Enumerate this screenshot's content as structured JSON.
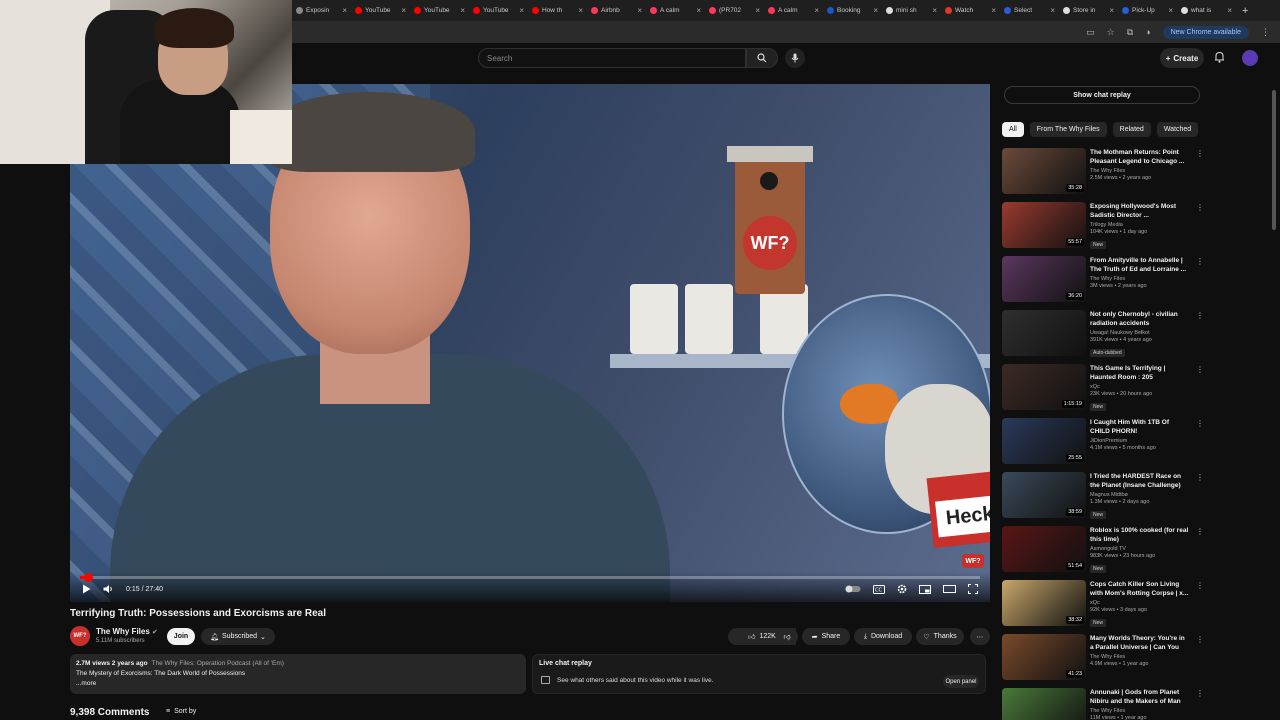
{
  "browser": {
    "tabs": [
      {
        "label": "Exposin",
        "color": "#888888"
      },
      {
        "label": "YouTube",
        "color": "#ff0000"
      },
      {
        "label": "YouTube",
        "color": "#ff0000"
      },
      {
        "label": "YouTube",
        "color": "#ff0000"
      },
      {
        "label": "How th",
        "color": "#ff0000"
      },
      {
        "label": "Airbnb",
        "color": "#ff385c"
      },
      {
        "label": "A calm",
        "color": "#ff385c"
      },
      {
        "label": "(PR702",
        "color": "#ff385c"
      },
      {
        "label": "A calm",
        "color": "#ff385c"
      },
      {
        "label": "Booking",
        "color": "#1a56c4"
      },
      {
        "label": "mini sh",
        "color": "#dddddd"
      },
      {
        "label": "Watch",
        "color": "#e2362b"
      },
      {
        "label": "Select",
        "color": "#2a5cd6"
      },
      {
        "label": "Store in",
        "color": "#dddddd"
      },
      {
        "label": "Pick-Up",
        "color": "#2a5cd6"
      },
      {
        "label": "what is",
        "color": "#dddddd"
      }
    ],
    "update_label": "New Chrome available"
  },
  "header": {
    "search_placeholder": "Search",
    "create_label": "Create"
  },
  "player": {
    "current_time": "0:15",
    "duration": "27:40",
    "time_display": "0:15 / 27:40",
    "progress": 0.009,
    "scene_text": {
      "wf_logo": "WF?",
      "tag": "Heck",
      "corner": "WF?"
    }
  },
  "video": {
    "title": "Terrifying Truth: Possessions and Exorcisms are Real",
    "channel": "The Why Files",
    "subscribers": "5.11M subscribers",
    "join_label": "Join",
    "subscribed_label": "Subscribed",
    "likes": "122K",
    "share_label": "Share",
    "download_label": "Download",
    "thanks_label": "Thanks"
  },
  "description": {
    "meta": "2.7M views  2 years ago",
    "link": "The Why Files: Operation Podcast (All of 'Em)",
    "line": "The Mystery of Exorcisms: The Dark World of Possessions",
    "more": "...more"
  },
  "livechat": {
    "title": "Live chat replay",
    "text": "See what others said about this video while it was live.",
    "open_label": "Open panel"
  },
  "comments": {
    "count_label": "9,398 Comments",
    "sort_label": "Sort by"
  },
  "sidebar": {
    "chat_replay_label": "Show chat replay",
    "chips": [
      "All",
      "From The Why Files",
      "Related",
      "Watched"
    ],
    "items": [
      {
        "title": "The Mothman Returns: Point Pleasant Legend to Chicago ...",
        "channel": "The Why Files",
        "views": "2.5M views • 2 years ago",
        "duration": "35:28",
        "badge": "",
        "color": "#6b4a3a"
      },
      {
        "title": "Exposing Hollywood's Most Sadistic Director ...",
        "channel": "Trilogy Media",
        "views": "104K views • 1 day ago",
        "duration": "55:57",
        "badge": "New",
        "color": "#9a3a2f"
      },
      {
        "title": "From Amityville to Annabelle | The Truth of Ed and Lorraine ...",
        "channel": "The Why Files",
        "views": "3M views • 2 years ago",
        "duration": "36:20",
        "badge": "",
        "color": "#5b3760"
      },
      {
        "title": "Not only Chernobyl - civilian radiation accidents",
        "channel": "Uwaga! Naukowy Bełkot",
        "views": "391K views • 4 years ago",
        "duration": "",
        "badge": "Auto-dubbed",
        "color": "#2f2f2f"
      },
      {
        "title": "This Game Is Terrifying | Haunted Room : 205",
        "channel": "xQc",
        "views": "23K views • 20 hours ago",
        "duration": "1:15:19",
        "badge": "New",
        "color": "#3c2a24"
      },
      {
        "title": "I Caught Him With 1TB Of CHILD PHORN!",
        "channel": "JiDionPremium",
        "views": "4.1M views • 5 months ago",
        "duration": "25:55",
        "badge": "",
        "color": "#2a3a5a"
      },
      {
        "title": "I Tried the HARDEST Race on the Planet (Insane Challenge)",
        "channel": "Magnus Midtbø",
        "views": "1.3M views • 2 days ago",
        "duration": "38:59",
        "badge": "New",
        "color": "#3a4a5a"
      },
      {
        "title": "Roblox is 100% cooked (for real this time)",
        "channel": "Asmongold TV",
        "views": "983K views • 23 hours ago",
        "duration": "51:54",
        "badge": "New",
        "color": "#5a1515"
      },
      {
        "title": "Cops Catch Killer Son Living with Mom's Rotting Corpse | x...",
        "channel": "xQc",
        "views": "92K views • 3 days ago",
        "duration": "38:32",
        "badge": "New",
        "color": "#c9a76a"
      },
      {
        "title": "Many Worlds Theory: You're in a Parallel Universe | Can You Visi...",
        "channel": "The Why Files",
        "views": "4.9M views • 1 year ago",
        "duration": "41:23",
        "badge": "",
        "color": "#7a4a2a"
      },
      {
        "title": "Annunaki | Gods from Planet Nibiru and the Makers of Man",
        "channel": "The Why Files",
        "views": "11M views • 1 year ago",
        "duration": "1:05:23",
        "badge": "",
        "color": "#4a7a3a"
      }
    ]
  },
  "colors": {
    "accent": "#ff0000",
    "brand": "#c92f2b"
  }
}
